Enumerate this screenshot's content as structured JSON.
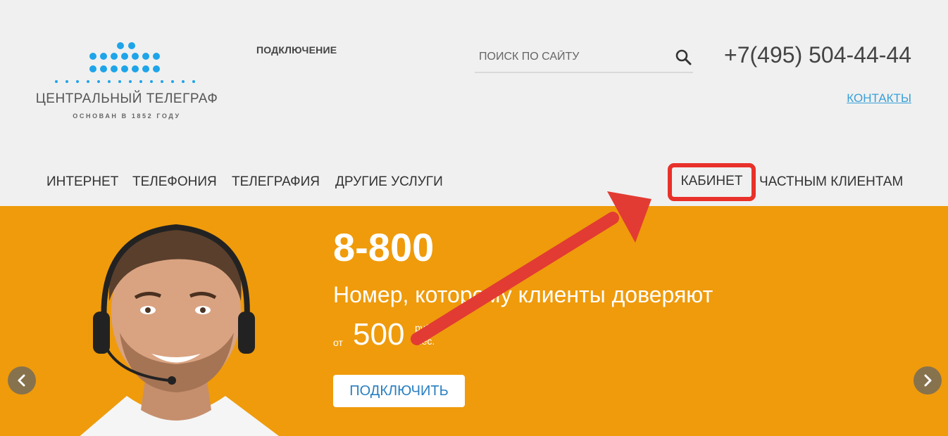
{
  "logo": {
    "title": "ЦЕНТРАЛЬНЫЙ ТЕЛЕГРАФ",
    "subtitle": "ОСНОВАН В 1852 ГОДУ",
    "dot_color": "#1ea4e9"
  },
  "top_link": {
    "label": "ПОДКЛЮЧЕНИЕ"
  },
  "search": {
    "placeholder": "ПОИСК ПО САЙТУ",
    "icon": "search-icon"
  },
  "phone": "+7(495) 504-44-44",
  "contacts_link": "КОНТАКТЫ",
  "nav": {
    "items": [
      "ИНТЕРНЕТ",
      "ТЕЛЕФОНИЯ",
      "ТЕЛЕГРАФИЯ",
      "ДРУГИЕ УСЛУГИ"
    ],
    "cabinet": "КАБИНЕТ",
    "private_clients": "ЧАСТНЫМ КЛИЕНТАМ"
  },
  "banner": {
    "headline": "8-800",
    "subline": "Номер, которому клиенты доверяют",
    "price_from": "от",
    "price_value": "500",
    "price_unit_top": "руб.",
    "price_unit_bottom": "мес.",
    "button": "ПОДКЛЮЧИТЬ",
    "background": "#ef9b0c"
  },
  "colors": {
    "highlight": "#e8312a",
    "link": "#3aa0d8"
  }
}
